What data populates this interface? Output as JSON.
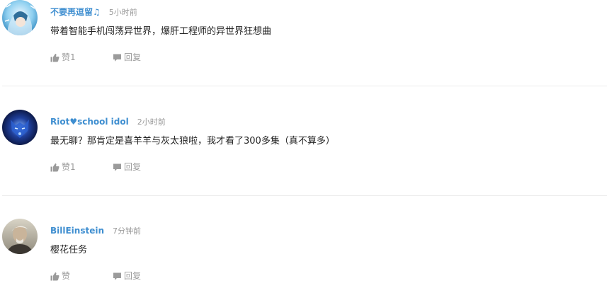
{
  "comments": [
    {
      "username": "不要再逗留♫",
      "time": "5小时前",
      "content": "带着智能手机闯荡异世界，爆肝工程师的异世界狂想曲",
      "like_label": "赞1",
      "reply_label": "回复",
      "avatar_icon": "anime-avatar-icon"
    },
    {
      "username": "Riot♥school idol",
      "time": "2小时前",
      "content": "最无聊？那肯定是喜羊羊与灰太狼啦，我才看了300多集（真不算多）",
      "like_label": "赞1",
      "reply_label": "回复",
      "avatar_icon": "blue-wolf-avatar-icon"
    },
    {
      "username": "BillEinstein",
      "time": "7分钟前",
      "content": "樱花任务",
      "like_label": "赞",
      "reply_label": "回复",
      "avatar_icon": "person-avatar-icon"
    }
  ],
  "colors": {
    "username": "#3e8ed0",
    "meta": "#999999",
    "text": "#222222",
    "divider": "#ececec"
  }
}
